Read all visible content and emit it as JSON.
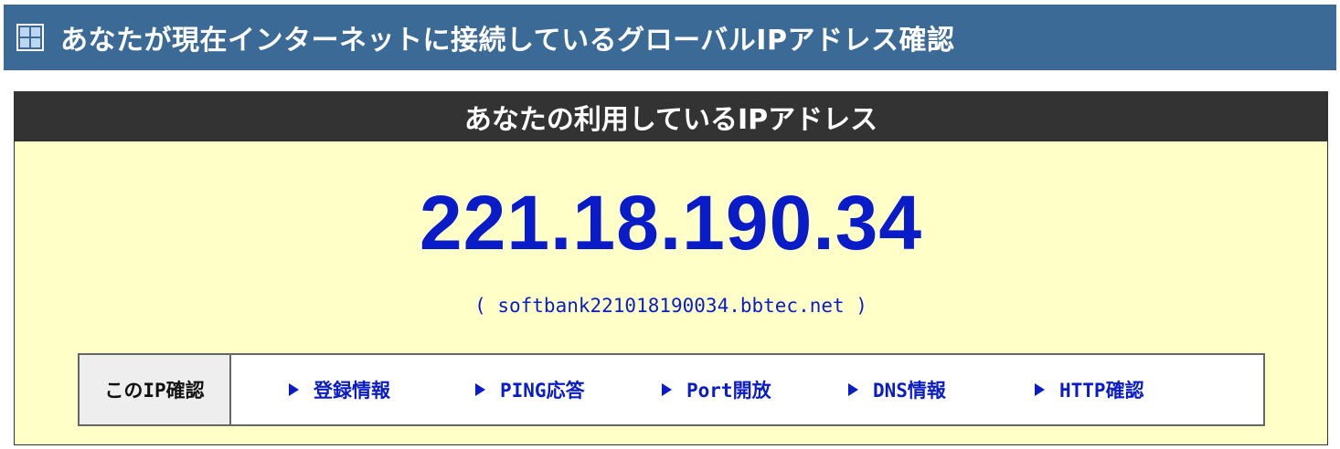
{
  "header": {
    "icon": "window-grid-icon",
    "title": "あなたが現在インターネットに接続しているグローバルIPアドレス確認"
  },
  "panel": {
    "heading": "あなたの利用しているIPアドレス",
    "ip_address": "221.18.190.34",
    "hostname": "( softbank221018190034.bbtec.net )"
  },
  "check": {
    "label": "このIP確認",
    "links": [
      {
        "label": "登録情報",
        "icon": "triangle-right-icon"
      },
      {
        "label": "PING応答",
        "icon": "triangle-right-icon"
      },
      {
        "label": "Port開放",
        "icon": "triangle-right-icon"
      },
      {
        "label": "DNS情報",
        "icon": "triangle-right-icon"
      },
      {
        "label": "HTTP確認",
        "icon": "triangle-right-icon"
      }
    ]
  },
  "colors": {
    "header_bg": "#3c6a97",
    "panel_head_bg": "#333333",
    "panel_bg": "#ffffc8",
    "accent_blue": "#0a1cc8"
  }
}
